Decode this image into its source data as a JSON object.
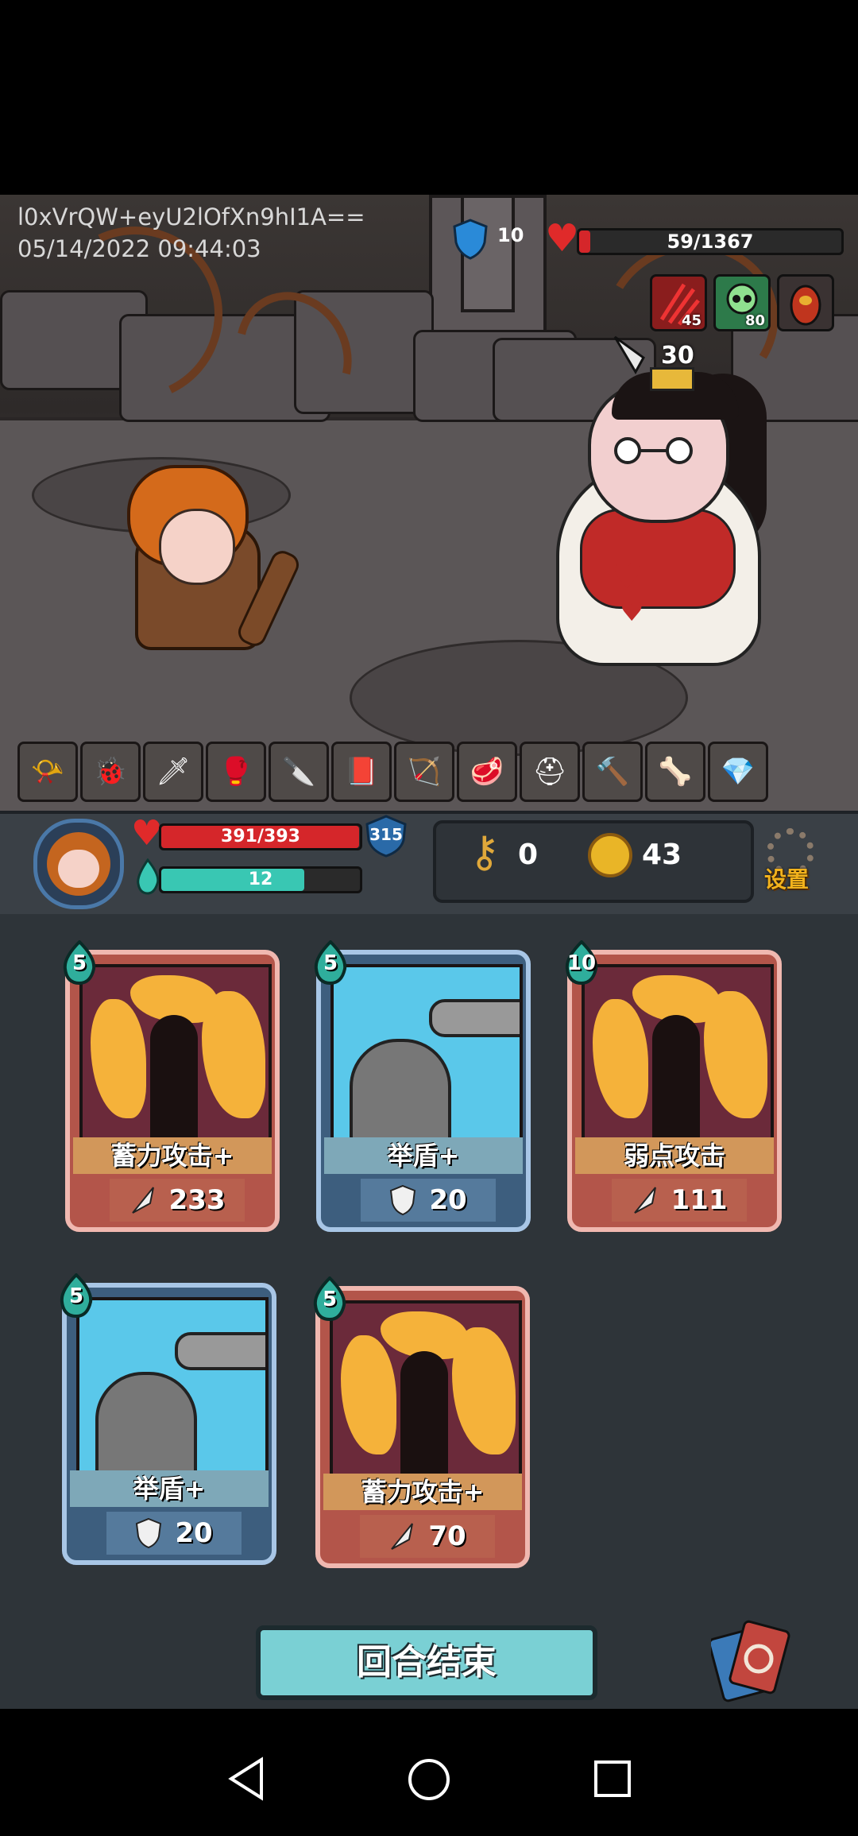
{
  "watermark": {
    "line1": "l0xVrQW+eyU2lOfXn9hI1A==",
    "line2": "05/14/2022 09:44:03"
  },
  "enemy": {
    "block": "10",
    "hp_text": "59/1367",
    "hp_fraction": 0.043,
    "statuses": [
      {
        "icon": "claw-slash-icon",
        "value": "45",
        "color": "#8a1d1d"
      },
      {
        "icon": "skull-icon",
        "value": "80",
        "color": "#2d7a4a"
      },
      {
        "icon": "egg-icon",
        "value": "",
        "color": "#c0351e"
      }
    ],
    "intent_value": "30"
  },
  "relics": [
    {
      "icon": "horn-icon",
      "glyph": "📯"
    },
    {
      "icon": "bug-icon",
      "glyph": "🐞"
    },
    {
      "icon": "dagger-potion-icon",
      "glyph": "🗡"
    },
    {
      "icon": "boxing-glove-icon",
      "glyph": "🥊"
    },
    {
      "icon": "sword-icon",
      "glyph": "🔪"
    },
    {
      "icon": "spellbook-icon",
      "glyph": "📕"
    },
    {
      "icon": "crossbow-icon",
      "glyph": "🏹"
    },
    {
      "icon": "meat-icon",
      "glyph": "🥩"
    },
    {
      "icon": "helmet-icon",
      "glyph": "⛑"
    },
    {
      "icon": "hammer-icon",
      "glyph": "🔨"
    },
    {
      "icon": "bone-icon",
      "glyph": "🦴"
    },
    {
      "icon": "crystal-icon",
      "glyph": "💎"
    }
  ],
  "player": {
    "hp_text": "391/393",
    "hp_fraction": 0.995,
    "energy_text": "12",
    "energy_fraction": 0.72,
    "shield": "315",
    "keys": "0",
    "coins": "43",
    "settings_label": "设置"
  },
  "cards": [
    {
      "type": "attack",
      "cost": "5",
      "title": "蓄力攻击+",
      "value": "233",
      "value_icon": "blade-icon"
    },
    {
      "type": "defense",
      "cost": "5",
      "title": "举盾+",
      "value": "20",
      "value_icon": "shield-icon"
    },
    {
      "type": "attack",
      "cost": "10",
      "title": "弱点攻击",
      "value": "111",
      "value_icon": "blade-icon"
    },
    {
      "type": "defense",
      "cost": "5",
      "title": "举盾+",
      "value": "20",
      "value_icon": "shield-icon"
    },
    {
      "type": "attack",
      "cost": "5",
      "title": "蓄力攻击+",
      "value": "70",
      "value_icon": "blade-icon"
    }
  ],
  "end_turn_label": "回合结束",
  "colors": {
    "hp_red": "#d5262a",
    "energy_teal": "#39c7b3",
    "gold": "#e9b527",
    "attack_card": "#b3554a",
    "defense_card": "#3d5e7e"
  }
}
